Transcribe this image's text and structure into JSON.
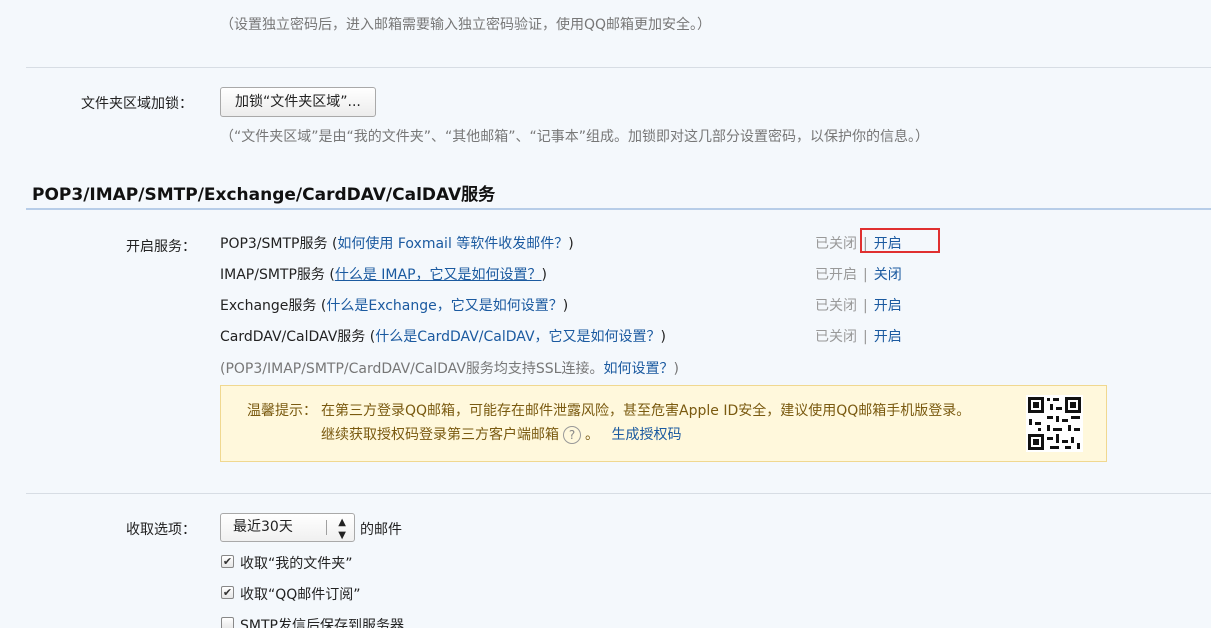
{
  "top_note": "（设置独立密码后，进入邮箱需要输入独立密码验证，使用QQ邮箱更加安全。）",
  "folder_lock": {
    "label": "文件夹区域加锁：",
    "button": "加锁“文件夹区域”...",
    "note": "（“文件夹区域”是由“我的文件夹”、“其他邮箱”、“记事本”组成。加锁即对这几部分设置密码，以保护你的信息。）"
  },
  "section_title": "POP3/IMAP/SMTP/Exchange/CardDAV/CalDAV服务",
  "services": {
    "label": "开启服务：",
    "separator": "|",
    "items": [
      {
        "name": "POP3/SMTP服务",
        "open_paren": "(",
        "help": "如何使用 Foxmail 等软件收发邮件？",
        "close_paren": ")",
        "status": "已关闭",
        "action": "开启"
      },
      {
        "name": "IMAP/SMTP服务",
        "open_paren": "(",
        "help": "什么是 IMAP，它又是如何设置？",
        "close_paren": ")",
        "status": "已开启",
        "action": "关闭"
      },
      {
        "name": "Exchange服务",
        "open_paren": "(",
        "help": "什么是Exchange，它又是如何设置？",
        "close_paren": ")",
        "status": "已关闭",
        "action": "开启"
      },
      {
        "name": "CardDAV/CalDAV服务",
        "open_paren": "(",
        "help": "什么是CardDAV/CalDAV，它又是如何设置？",
        "close_paren": ")",
        "status": "已关闭",
        "action": "开启"
      }
    ],
    "ssl_note_prefix": "(POP3/IMAP/SMTP/CardDAV/CalDAV服务均支持SSL连接。",
    "ssl_note_link": "如何设置？",
    "ssl_note_suffix": ")"
  },
  "tip": {
    "label": "温馨提示：",
    "line1": "在第三方登录QQ邮箱，可能存在邮件泄露风险，甚至危害Apple ID安全，建议使用QQ邮箱手机版登录。",
    "line2": "继续获取授权码登录第三方客户端邮箱",
    "question_mark": "?",
    "period": "。",
    "link": "生成授权码"
  },
  "receive": {
    "label": "收取选项：",
    "select_value": "最近30天",
    "select_suffix": "的邮件",
    "options": [
      {
        "label": "收取“我的文件夹”",
        "checked": true
      },
      {
        "label": "收取“QQ邮件订阅”",
        "checked": true
      },
      {
        "label": "SMTP发信后保存到服务器",
        "checked": false
      }
    ]
  },
  "colors": {
    "link": "#1b5aa0",
    "highlight": "#e03030",
    "tip_bg": "#fff8dc"
  }
}
